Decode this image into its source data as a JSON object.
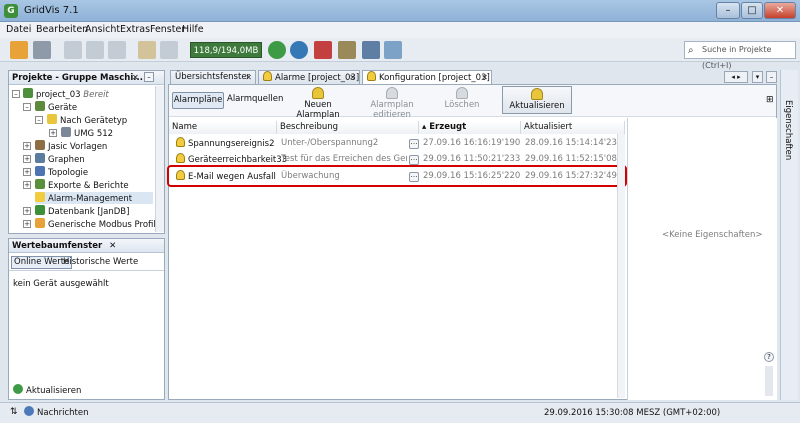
{
  "window": {
    "title": "GridVis 7.1",
    "app_icon": "gridvis-logo-icon"
  },
  "menu": [
    "Datei",
    "Bearbeiten",
    "Ansicht",
    "Extras",
    "Fenster",
    "Hilfe"
  ],
  "toolbar": {
    "memory": "118,9/194,0MB",
    "search_placeholder": "Suche in Projekte (Ctrl+I)"
  },
  "projects_panel": {
    "title": "Projekte - Gruppe Maschi...",
    "tree": [
      {
        "label": "project_03",
        "suffix": "Bereit"
      },
      {
        "label": "Geräte"
      },
      {
        "label": "Nach Gerätetyp"
      },
      {
        "label": "UMG 512"
      },
      {
        "label": "Jasic Vorlagen"
      },
      {
        "label": "Graphen"
      },
      {
        "label": "Topologie"
      },
      {
        "label": "Exporte & Berichte"
      },
      {
        "label": "Alarm-Management"
      },
      {
        "label": "Datenbank [JanDB]"
      },
      {
        "label": "Generische Modbus Profile"
      }
    ]
  },
  "values_panel": {
    "title": "Wertebaumfenster",
    "tabs": [
      "Online Werte",
      "Historische Werte"
    ],
    "message": "kein Gerät ausgewählt",
    "refresh": "Aktualisieren"
  },
  "editor_tabs": [
    "Übersichtsfenster",
    "Alarme [project_03]",
    "Konfiguration [project_03]"
  ],
  "sub_tabs": [
    "Alarmpläne",
    "Alarmquellen"
  ],
  "actions": {
    "new_plan": "Neuen Alarmplan",
    "edit_plan": "Alarmplan editieren",
    "delete": "Löschen",
    "refresh": "Aktualisieren"
  },
  "table": {
    "columns": [
      "Name",
      "Beschreibung",
      "Erzeugt",
      "Aktualisiert"
    ],
    "rows": [
      {
        "name": "Spannungsereignis2",
        "description": "Unter-/Oberspannung2",
        "created": "27.09.16 16:16:19'190",
        "updated": "28.09.16 15:14:14'238"
      },
      {
        "name": "Geräteerreichbarkeit33",
        "description": "Test für das Erreichen des Geräts...",
        "created": "29.09.16 11:50:21'233",
        "updated": "29.09.16 11:52:15'085"
      },
      {
        "name": "E-Mail wegen Ausfall",
        "description": "Überwachung",
        "created": "29.09.16 15:16:25'220",
        "updated": "29.09.16 15:27:32'494"
      }
    ]
  },
  "properties": {
    "side_label": "Eigenschaften",
    "empty": "<Keine Eigenschaften>"
  },
  "status": {
    "notifications": "Nachrichten",
    "datetime": "29.09.2016 15:30:08 MESZ (GMT+02:00)"
  },
  "colors": {
    "highlight_border": "#d40000",
    "title_bar": "#a9c6e4",
    "memory_bg": "#3e7a3c"
  }
}
